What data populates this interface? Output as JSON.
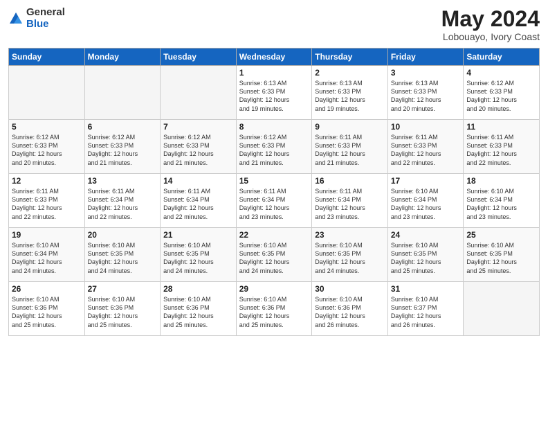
{
  "header": {
    "logo": {
      "general": "General",
      "blue": "Blue"
    },
    "title": "May 2024",
    "location": "Lobouayo, Ivory Coast"
  },
  "weekdays": [
    "Sunday",
    "Monday",
    "Tuesday",
    "Wednesday",
    "Thursday",
    "Friday",
    "Saturday"
  ],
  "weeks": [
    [
      {
        "day": "",
        "info": ""
      },
      {
        "day": "",
        "info": ""
      },
      {
        "day": "",
        "info": ""
      },
      {
        "day": "1",
        "info": "Sunrise: 6:13 AM\nSunset: 6:33 PM\nDaylight: 12 hours\nand 19 minutes."
      },
      {
        "day": "2",
        "info": "Sunrise: 6:13 AM\nSunset: 6:33 PM\nDaylight: 12 hours\nand 19 minutes."
      },
      {
        "day": "3",
        "info": "Sunrise: 6:13 AM\nSunset: 6:33 PM\nDaylight: 12 hours\nand 20 minutes."
      },
      {
        "day": "4",
        "info": "Sunrise: 6:12 AM\nSunset: 6:33 PM\nDaylight: 12 hours\nand 20 minutes."
      }
    ],
    [
      {
        "day": "5",
        "info": "Sunrise: 6:12 AM\nSunset: 6:33 PM\nDaylight: 12 hours\nand 20 minutes."
      },
      {
        "day": "6",
        "info": "Sunrise: 6:12 AM\nSunset: 6:33 PM\nDaylight: 12 hours\nand 21 minutes."
      },
      {
        "day": "7",
        "info": "Sunrise: 6:12 AM\nSunset: 6:33 PM\nDaylight: 12 hours\nand 21 minutes."
      },
      {
        "day": "8",
        "info": "Sunrise: 6:12 AM\nSunset: 6:33 PM\nDaylight: 12 hours\nand 21 minutes."
      },
      {
        "day": "9",
        "info": "Sunrise: 6:11 AM\nSunset: 6:33 PM\nDaylight: 12 hours\nand 21 minutes."
      },
      {
        "day": "10",
        "info": "Sunrise: 6:11 AM\nSunset: 6:33 PM\nDaylight: 12 hours\nand 22 minutes."
      },
      {
        "day": "11",
        "info": "Sunrise: 6:11 AM\nSunset: 6:33 PM\nDaylight: 12 hours\nand 22 minutes."
      }
    ],
    [
      {
        "day": "12",
        "info": "Sunrise: 6:11 AM\nSunset: 6:33 PM\nDaylight: 12 hours\nand 22 minutes."
      },
      {
        "day": "13",
        "info": "Sunrise: 6:11 AM\nSunset: 6:34 PM\nDaylight: 12 hours\nand 22 minutes."
      },
      {
        "day": "14",
        "info": "Sunrise: 6:11 AM\nSunset: 6:34 PM\nDaylight: 12 hours\nand 22 minutes."
      },
      {
        "day": "15",
        "info": "Sunrise: 6:11 AM\nSunset: 6:34 PM\nDaylight: 12 hours\nand 23 minutes."
      },
      {
        "day": "16",
        "info": "Sunrise: 6:11 AM\nSunset: 6:34 PM\nDaylight: 12 hours\nand 23 minutes."
      },
      {
        "day": "17",
        "info": "Sunrise: 6:10 AM\nSunset: 6:34 PM\nDaylight: 12 hours\nand 23 minutes."
      },
      {
        "day": "18",
        "info": "Sunrise: 6:10 AM\nSunset: 6:34 PM\nDaylight: 12 hours\nand 23 minutes."
      }
    ],
    [
      {
        "day": "19",
        "info": "Sunrise: 6:10 AM\nSunset: 6:34 PM\nDaylight: 12 hours\nand 24 minutes."
      },
      {
        "day": "20",
        "info": "Sunrise: 6:10 AM\nSunset: 6:35 PM\nDaylight: 12 hours\nand 24 minutes."
      },
      {
        "day": "21",
        "info": "Sunrise: 6:10 AM\nSunset: 6:35 PM\nDaylight: 12 hours\nand 24 minutes."
      },
      {
        "day": "22",
        "info": "Sunrise: 6:10 AM\nSunset: 6:35 PM\nDaylight: 12 hours\nand 24 minutes."
      },
      {
        "day": "23",
        "info": "Sunrise: 6:10 AM\nSunset: 6:35 PM\nDaylight: 12 hours\nand 24 minutes."
      },
      {
        "day": "24",
        "info": "Sunrise: 6:10 AM\nSunset: 6:35 PM\nDaylight: 12 hours\nand 25 minutes."
      },
      {
        "day": "25",
        "info": "Sunrise: 6:10 AM\nSunset: 6:35 PM\nDaylight: 12 hours\nand 25 minutes."
      }
    ],
    [
      {
        "day": "26",
        "info": "Sunrise: 6:10 AM\nSunset: 6:36 PM\nDaylight: 12 hours\nand 25 minutes."
      },
      {
        "day": "27",
        "info": "Sunrise: 6:10 AM\nSunset: 6:36 PM\nDaylight: 12 hours\nand 25 minutes."
      },
      {
        "day": "28",
        "info": "Sunrise: 6:10 AM\nSunset: 6:36 PM\nDaylight: 12 hours\nand 25 minutes."
      },
      {
        "day": "29",
        "info": "Sunrise: 6:10 AM\nSunset: 6:36 PM\nDaylight: 12 hours\nand 25 minutes."
      },
      {
        "day": "30",
        "info": "Sunrise: 6:10 AM\nSunset: 6:36 PM\nDaylight: 12 hours\nand 26 minutes."
      },
      {
        "day": "31",
        "info": "Sunrise: 6:10 AM\nSunset: 6:37 PM\nDaylight: 12 hours\nand 26 minutes."
      },
      {
        "day": "",
        "info": ""
      }
    ]
  ]
}
